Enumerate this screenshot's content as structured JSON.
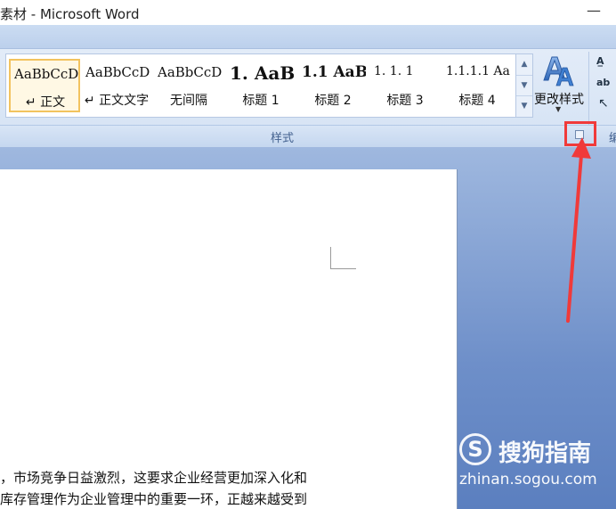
{
  "window": {
    "title": "素材 - Microsoft Word",
    "minimize_glyph": "—"
  },
  "ribbon": {
    "styles_gallery": [
      {
        "sample": "AaBbCcDc",
        "name": "↵ 正文",
        "selected": true
      },
      {
        "sample": "AaBbCcDc",
        "name": "↵ 正文文字",
        "selected": false
      },
      {
        "sample": "AaBbCcDc",
        "name": "无间隔",
        "selected": false
      },
      {
        "sample": "1. AaB",
        "name": "标题 1",
        "selected": false
      },
      {
        "sample": "1.1 AaBl",
        "name": "标题 2",
        "selected": false
      },
      {
        "sample": "1. 1. 1",
        "name": "标题 3",
        "selected": false
      },
      {
        "sample": "1.1.1.1 Aa",
        "name": "标题 4",
        "selected": false
      }
    ],
    "scroll_up": "▲",
    "scroll_down": "▼",
    "scroll_more": "▼",
    "change_styles_label": "更改样式",
    "change_styles_arrow": "▼",
    "styles_group_label": "样式",
    "editing_group_label": "编",
    "launcher_glyph": "↘",
    "edit_icons": [
      "A̲",
      "ab",
      "↖"
    ]
  },
  "document": {
    "lines": [
      "，市场竞争日益激烈，这要求企业经营更加深入化和",
      "库存管理作为企业管理中的重要一环，正越来越受到"
    ]
  },
  "watermark": {
    "logo_char": "S",
    "text": "搜狗指南",
    "url": "zhinan.sogou.com"
  },
  "colors": {
    "highlight": "#f03a3a",
    "selected_border": "#f2c35f",
    "workspace": "#6e8fc9"
  }
}
